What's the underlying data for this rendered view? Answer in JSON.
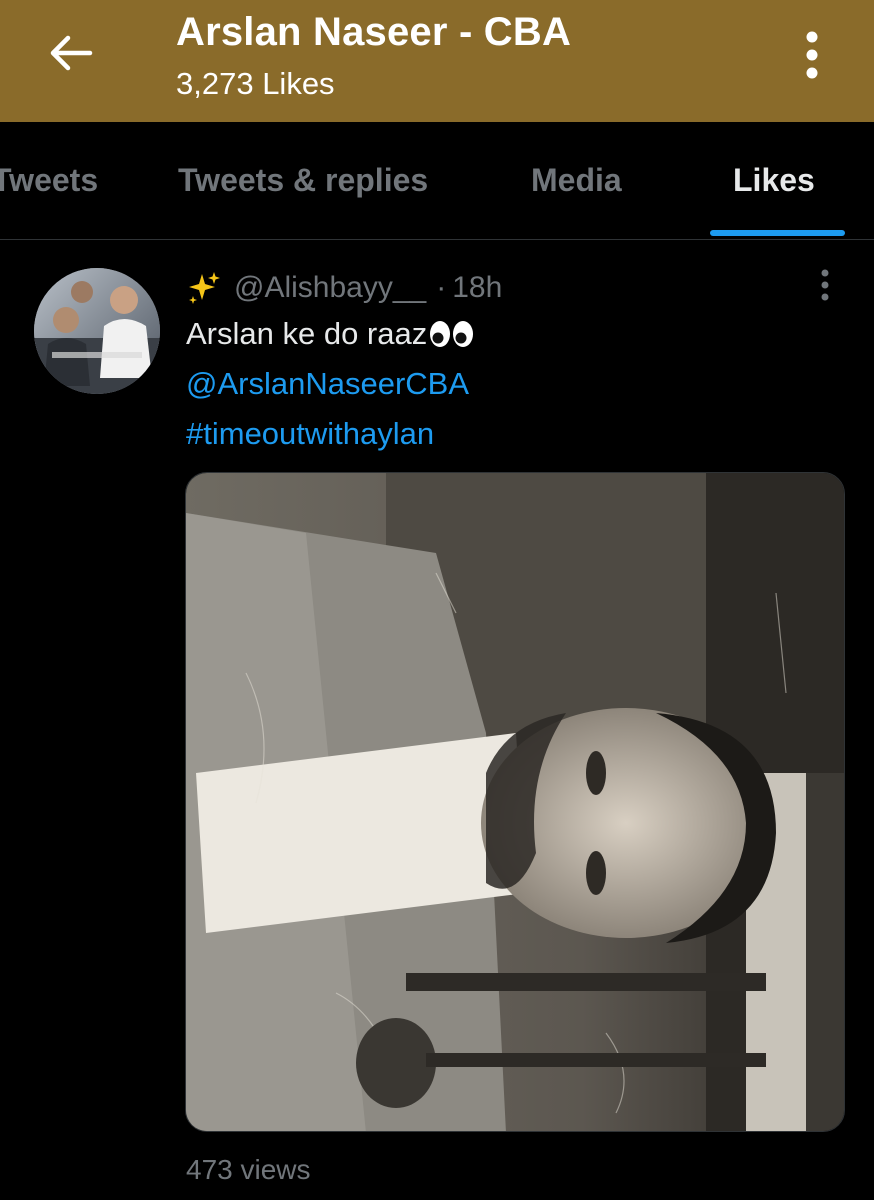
{
  "colors": {
    "header_bg": "#8a6b2a",
    "background": "#000000",
    "accent": "#1d9bf0",
    "muted_text": "#71767b",
    "primary_text": "#e7e9ea"
  },
  "header": {
    "back_icon": "arrow-left-icon",
    "title": "Arslan Naseer - CBA",
    "subtitle": "3,273 Likes",
    "more_icon": "more-vertical-icon"
  },
  "tabs": [
    {
      "label": "Tweets",
      "active": false
    },
    {
      "label": "Tweets & replies",
      "active": false
    },
    {
      "label": "Media",
      "active": false
    },
    {
      "label": "Likes",
      "active": true
    }
  ],
  "tweet": {
    "avatar_icon": "profile-photo",
    "name_emoji_icon": "sparkles-icon",
    "handle": "@Alishbayy__",
    "separator": "·",
    "time": "18h",
    "text": "Arslan ke do raaz",
    "text_emoji_icon": "eyes-icon",
    "mention": "@ArslanNaseerCBA",
    "hashtag": "#timeoutwithaylan",
    "media_icon": "video-thumbnail",
    "more_icon": "more-vertical-icon",
    "views": "473 views"
  }
}
